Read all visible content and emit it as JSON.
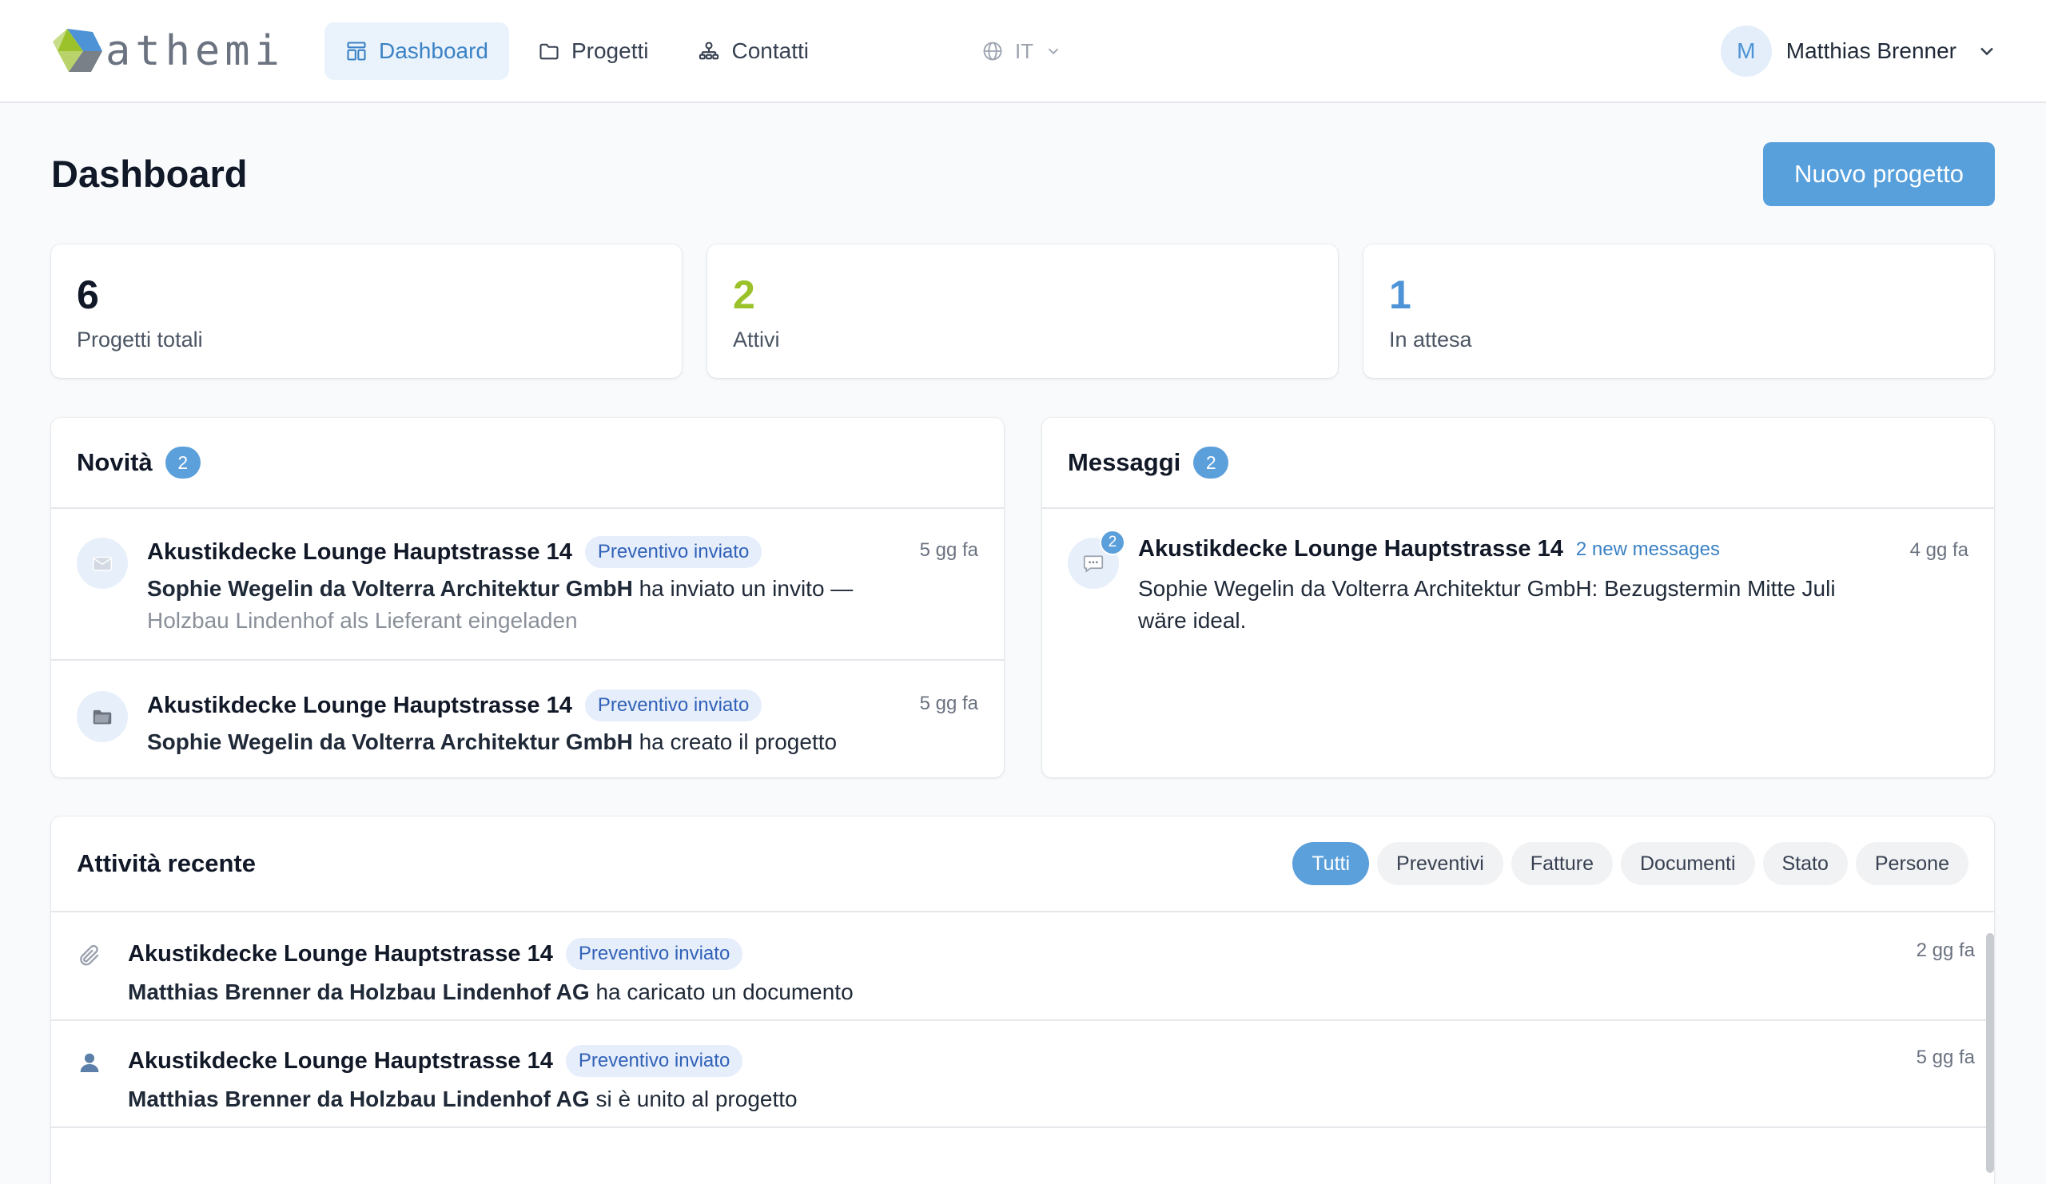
{
  "brand": {
    "name": "athemi",
    "colors": {
      "green": "#9bc22a",
      "blue": "#4d93d6",
      "gray": "#6b7280"
    }
  },
  "nav": {
    "items": [
      {
        "label": "Dashboard",
        "icon": "dashboard-icon",
        "active": true
      },
      {
        "label": "Progetti",
        "icon": "folder-icon"
      },
      {
        "label": "Contatti",
        "icon": "contacts-icon"
      }
    ]
  },
  "language": {
    "code": "IT",
    "icon": "globe-icon"
  },
  "user": {
    "initial": "M",
    "name": "Matthias Brenner"
  },
  "page": {
    "title": "Dashboard",
    "new_project_label": "Nuovo progetto"
  },
  "stats": [
    {
      "value": "6",
      "label": "Progetti totali",
      "color": "#111827"
    },
    {
      "value": "2",
      "label": "Attivi",
      "color": "#9bc22a"
    },
    {
      "value": "1",
      "label": "In attesa",
      "color": "#4d93d6"
    }
  ],
  "news": {
    "title": "Novità",
    "count": "2",
    "items": [
      {
        "icon": "envelope-icon",
        "project": "Akustikdecke Lounge Hauptstrasse 14",
        "status": "Preventivo inviato",
        "time": "5 gg fa",
        "actor": "Sophie Wegelin da Volterra Architektur GmbH",
        "action": "ha inviato un invito —",
        "detail": "Holzbau Lindenhof als Lieferant eingeladen"
      },
      {
        "icon": "folder-icon",
        "project": "Akustikdecke Lounge Hauptstrasse 14",
        "status": "Preventivo inviato",
        "time": "5 gg fa",
        "actor": "Sophie Wegelin da Volterra Architektur GmbH",
        "action": "ha creato il progetto"
      }
    ]
  },
  "messages": {
    "title": "Messaggi",
    "count": "2",
    "items": [
      {
        "icon": "speech-bubble-icon",
        "unread": "2",
        "project": "Akustikdecke Lounge Hauptstrasse 14",
        "new_label": "2 new messages",
        "time": "4 gg fa",
        "text_line1": "Sophie Wegelin da Volterra Architektur GmbH: Bezugstermin Mitte Juli",
        "text_line2": "wäre ideal."
      }
    ]
  },
  "activity": {
    "title": "Attività recente",
    "filters": [
      "Tutti",
      "Preventivi",
      "Fatture",
      "Documenti",
      "Stato",
      "Persone"
    ],
    "active_filter": "Tutti",
    "items": [
      {
        "icon": "paperclip-icon",
        "project": "Akustikdecke Lounge Hauptstrasse 14",
        "status": "Preventivo inviato",
        "time": "2 gg fa",
        "actor": "Matthias Brenner da Holzbau Lindenhof AG",
        "action": "ha caricato un documento"
      },
      {
        "icon": "person-icon",
        "project": "Akustikdecke Lounge Hauptstrasse 14",
        "status": "Preventivo inviato",
        "time": "5 gg fa",
        "actor": "Matthias Brenner da Holzbau Lindenhof AG",
        "action": "si è unito al progetto"
      }
    ]
  }
}
